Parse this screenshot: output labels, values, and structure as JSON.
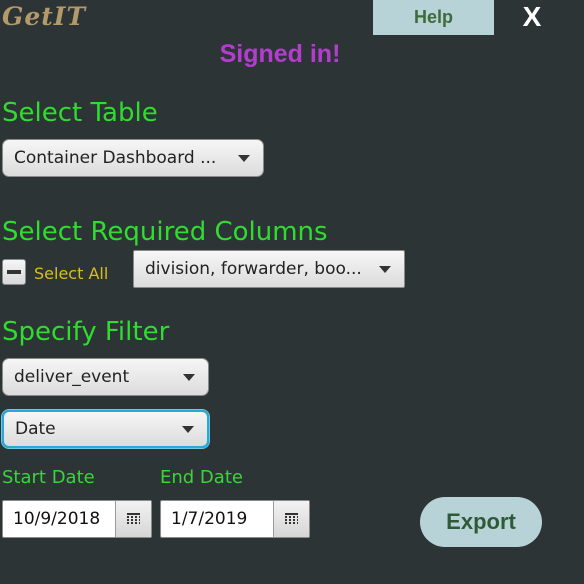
{
  "app": {
    "logo": "GetIT",
    "help_label": "Help",
    "close_label": "X",
    "status": "Signed in!"
  },
  "colors": {
    "background": "#2d3436",
    "heading": "#2fdc2f",
    "status": "#b43ccf",
    "button": "#b7d3d8",
    "focus": "#2aa8d9",
    "select_all_label": "#d8bf1f"
  },
  "select_table": {
    "heading": "Select Table",
    "value": "Container Dashboard ..."
  },
  "select_columns": {
    "heading": "Select Required Columns",
    "select_all_label": "Select All",
    "select_all_state": "indeterminate",
    "value": "division, forwarder, boo..."
  },
  "filter": {
    "heading": "Specify Filter",
    "field_value": "deliver_event",
    "type_value": "Date",
    "start_label": "Start Date",
    "end_label": "End Date",
    "start_value": "10/9/2018",
    "end_value": "1/7/2019"
  },
  "actions": {
    "export_label": "Export"
  },
  "icons": {
    "dropdown": "chevron-down-icon",
    "calendar": "calendar-icon",
    "checkbox": "indeterminate-dash-icon"
  }
}
